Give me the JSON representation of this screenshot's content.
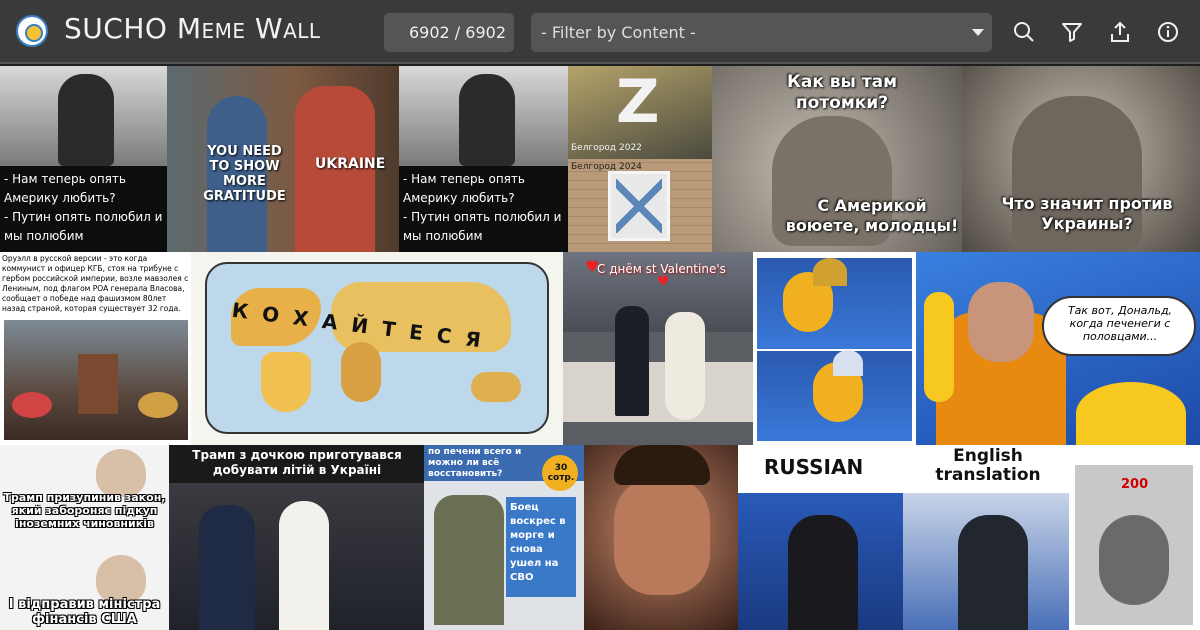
{
  "header": {
    "title": "SUCHO Meme Wall",
    "counter": "6902 / 6902",
    "filter_placeholder": "- Filter by Content -",
    "tools": [
      "search-icon",
      "filter-icon",
      "share-icon",
      "info-icon"
    ]
  },
  "tiles": {
    "t1_caption": "- Нам теперь опять Америку любить?\n- Путин опять полюбил и мы полюбим",
    "t2_left": "YOU NEED TO SHOW MORE GRATITUDE",
    "t2_right": "UKRAINE",
    "t3_caption": "- Нам теперь опять Америку любить?\n- Путин опять полюбил и мы полюбим",
    "t4_top_caption": "Белгород 2022",
    "t4_bottom_caption": "Белгород 2024",
    "t5_caption": "Как вы там потомки?",
    "t5_bottom": "С Америкой воюете, молодцы!",
    "t6_caption": "Что значит против Украины?",
    "t7_text": "Оруэлл в русской версии - это когда коммунист и офицер КГБ, стоя на трибуне с гербом российской империи, возле мавзолея с Лениным, под флагом РОА генерала Власова, сообщает о победе над фашизмом 80лет назад страной, которая существует 32 года.",
    "t8_caption": "КОХАЙТЕСЯ",
    "t9_caption": "С днём st Valentine's",
    "t11_bubble": "Так вот, Дональд, когда печенеги с половцами...",
    "t12_top": "Трамп призупинив закон, який забороняє підкуп іноземних чиновників",
    "t12_bottom": "І відправив міністра фінансів США",
    "t13_caption": "Трамп з дочкою приготувався добувати літій в Україні",
    "t14_caption": "по печени всего и можно ли всё восстановить?",
    "t14_badge": "30 сотр.",
    "t14_bubble": "Боец воскрес в морге и снова ушел на СВО",
    "t16_left": "RUSSIAN",
    "t16_right": "English translation",
    "t17_label": "200"
  },
  "colors": {
    "topbar": "#3a3a3a",
    "field": "#555555",
    "accent_yellow": "#f2b705"
  }
}
